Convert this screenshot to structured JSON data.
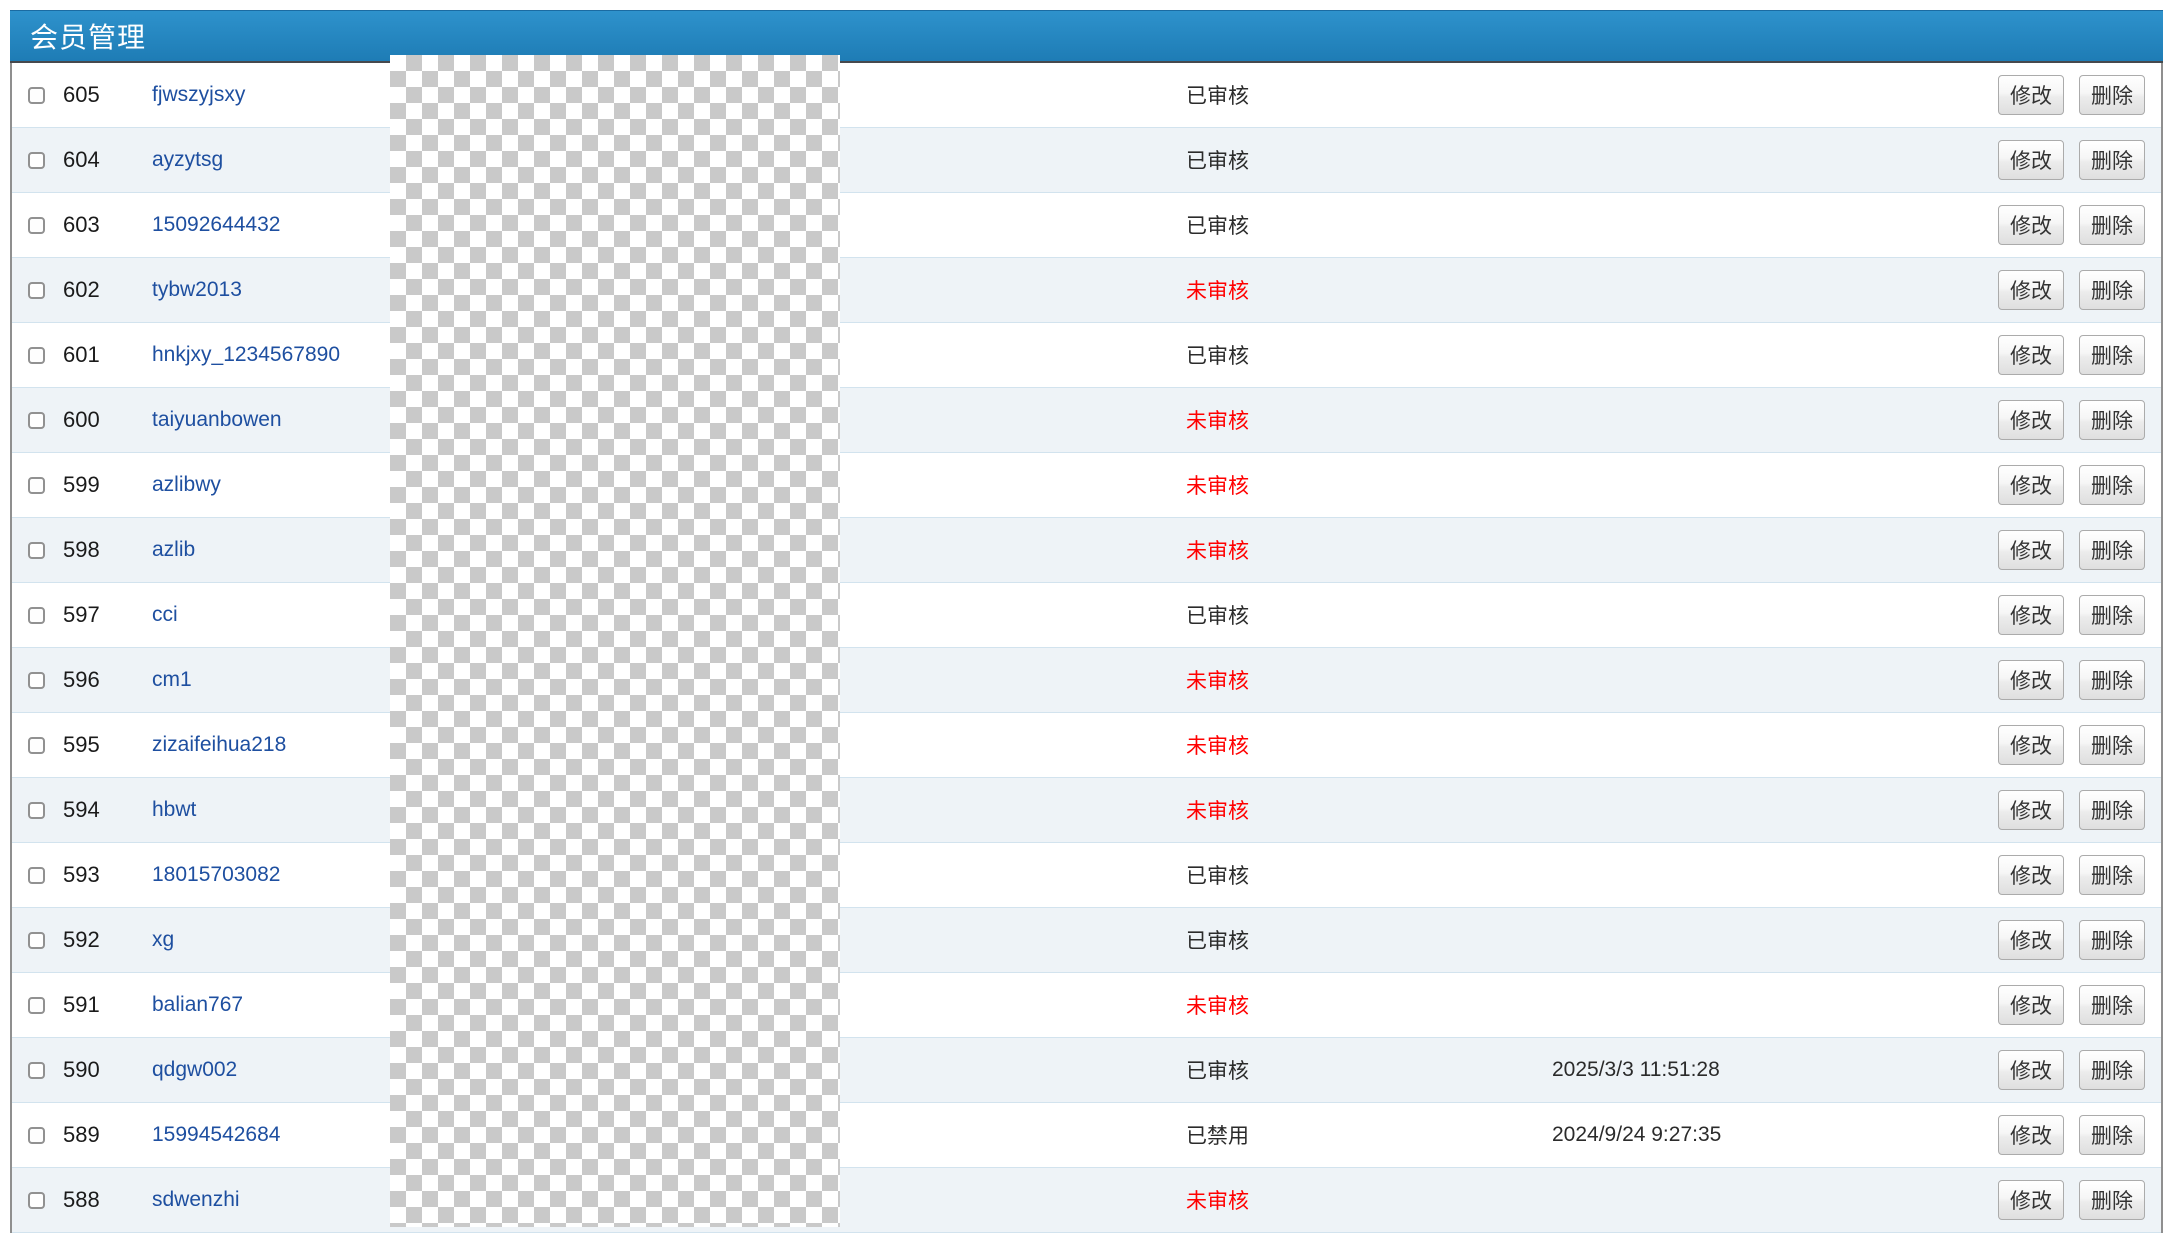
{
  "header": {
    "title": "会员管理"
  },
  "actions": {
    "edit": "修改",
    "delete": "删除"
  },
  "status_labels": {
    "approved": "已审核",
    "pending": "未审核",
    "disabled": "已禁用"
  },
  "colors": {
    "header_gradient_top": "#2e92cc",
    "header_gradient_bottom": "#1e7cb5",
    "link_blue": "#1e4fa0",
    "status_red": "#ff0000",
    "row_alt_bg": "#eef3f7",
    "row_divider": "#d2e3ee",
    "table_border": "#8f8f8f"
  },
  "rows": [
    {
      "id": "605",
      "username": "fjwszyjsxy",
      "status": "已审核",
      "alert": false,
      "date": ""
    },
    {
      "id": "604",
      "username": "ayzytsg",
      "status": "已审核",
      "alert": false,
      "date": ""
    },
    {
      "id": "603",
      "username": "15092644432",
      "status": "已审核",
      "alert": false,
      "date": ""
    },
    {
      "id": "602",
      "username": "tybw2013",
      "status": "未审核",
      "alert": true,
      "date": ""
    },
    {
      "id": "601",
      "username": "hnkjxy_1234567890",
      "status": "已审核",
      "alert": false,
      "date": ""
    },
    {
      "id": "600",
      "username": "taiyuanbowen",
      "status": "未审核",
      "alert": true,
      "date": ""
    },
    {
      "id": "599",
      "username": "azlibwy",
      "status": "未审核",
      "alert": true,
      "date": ""
    },
    {
      "id": "598",
      "username": "azlib",
      "status": "未审核",
      "alert": true,
      "date": ""
    },
    {
      "id": "597",
      "username": "cci",
      "status": "已审核",
      "alert": false,
      "date": ""
    },
    {
      "id": "596",
      "username": "cm1",
      "status": "未审核",
      "alert": true,
      "date": ""
    },
    {
      "id": "595",
      "username": "zizaifeihua218",
      "status": "未审核",
      "alert": true,
      "date": ""
    },
    {
      "id": "594",
      "username": "hbwt",
      "status": "未审核",
      "alert": true,
      "date": ""
    },
    {
      "id": "593",
      "username": "18015703082",
      "status": "已审核",
      "alert": false,
      "date": ""
    },
    {
      "id": "592",
      "username": "xg",
      "status": "已审核",
      "alert": false,
      "date": ""
    },
    {
      "id": "591",
      "username": "balian767",
      "status": "未审核",
      "alert": true,
      "date": ""
    },
    {
      "id": "590",
      "username": "qdgw002",
      "status": "已审核",
      "alert": false,
      "date": "2025/3/3 11:51:28"
    },
    {
      "id": "589",
      "username": "15994542684",
      "status": "已禁用",
      "alert": false,
      "date": "2024/9/24 9:27:35"
    },
    {
      "id": "588",
      "username": "sdwenzhi",
      "status": "未审核",
      "alert": true,
      "date": ""
    }
  ]
}
